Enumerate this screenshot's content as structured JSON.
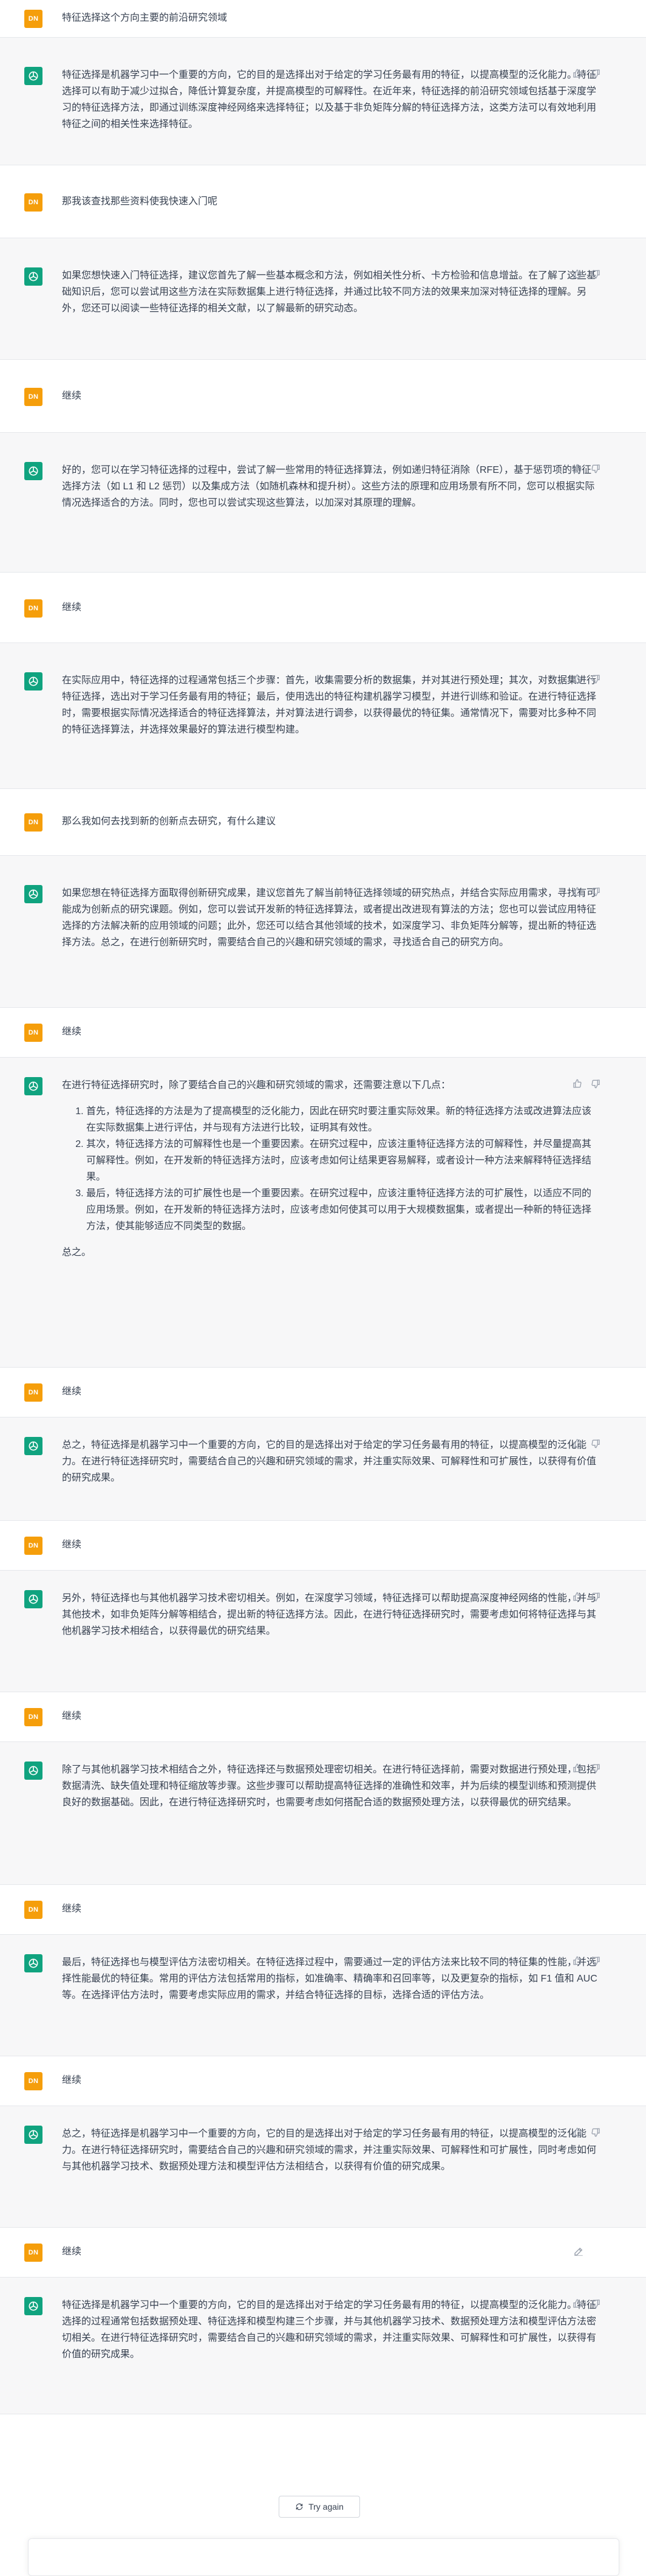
{
  "conversation": {
    "m0": {
      "avatar": "DN",
      "text": "特征选择这个方向主要的前沿研究领域"
    },
    "m1": {
      "text": "特征选择是机器学习中一个重要的方向，它的目的是选择出对于给定的学习任务最有用的特征，以提高模型的泛化能力。特征选择可以有助于减少过拟合，降低计算复杂度，并提高模型的可解释性。在近年来，特征选择的前沿研究领域包括基于深度学习的特征选择方法，即通过训练深度神经网络来选择特征；以及基于非负矩阵分解的特征选择方法，这类方法可以有效地利用特征之间的相关性来选择特征。"
    },
    "m2": {
      "avatar": "DN",
      "text": "那我该查找那些资料使我快速入门呢"
    },
    "m3": {
      "text": "如果您想快速入门特征选择，建议您首先了解一些基本概念和方法，例如相关性分析、卡方检验和信息增益。在了解了这些基础知识后，您可以尝试用这些方法在实际数据集上进行特征选择，并通过比较不同方法的效果来加深对特征选择的理解。另外，您还可以阅读一些特征选择的相关文献，以了解最新的研究动态。"
    },
    "m4": {
      "avatar": "DN",
      "text": "继续"
    },
    "m5": {
      "text": "好的，您可以在学习特征选择的过程中，尝试了解一些常用的特征选择算法，例如递归特征消除（RFE），基于惩罚项的特征选择方法（如 L1 和 L2 惩罚）以及集成方法（如随机森林和提升树）。这些方法的原理和应用场景有所不同，您可以根据实际情况选择适合的方法。同时，您也可以尝试实现这些算法，以加深对其原理的理解。"
    },
    "m6": {
      "avatar": "DN",
      "text": "继续"
    },
    "m7": {
      "text": "在实际应用中，特征选择的过程通常包括三个步骤：首先，收集需要分析的数据集，并对其进行预处理；其次，对数据集进行特征选择，选出对于学习任务最有用的特征；最后，使用选出的特征构建机器学习模型，并进行训练和验证。在进行特征选择时，需要根据实际情况选择适合的特征选择算法，并对算法进行调参，以获得最优的特征集。通常情况下，需要对比多种不同的特征选择算法，并选择效果最好的算法进行模型构建。"
    },
    "m8": {
      "avatar": "DN",
      "text": "那么我如何去找到新的创新点去研究，有什么建议"
    },
    "m9": {
      "text": "如果您想在特征选择方面取得创新研究成果，建议您首先了解当前特征选择领域的研究热点，并结合实际应用需求，寻找有可能成为创新点的研究课题。例如，您可以尝试开发新的特征选择算法，或者提出改进现有算法的方法；您也可以尝试应用特征选择的方法解决新的应用领域的问题；此外，您还可以结合其他领域的技术，如深度学习、非负矩阵分解等，提出新的特征选择方法。总之，在进行创新研究时，需要结合自己的兴趣和研究领域的需求，寻找适合自己的研究方向。"
    },
    "m10": {
      "avatar": "DN",
      "text": "继续"
    },
    "m11": {
      "intro": "在进行特征选择研究时，除了要结合自己的兴趣和研究领域的需求，还需要注意以下几点：",
      "items": [
        "首先，特征选择的方法是为了提高模型的泛化能力，因此在研究时要注重实际效果。新的特征选择方法或改进算法应该在实际数据集上进行评估，并与现有方法进行比较，证明其有效性。",
        "其次，特征选择方法的可解释性也是一个重要因素。在研究过程中，应该注重特征选择方法的可解释性，并尽量提高其可解释性。例如，在开发新的特征选择方法时，应该考虑如何让结果更容易解释，或者设计一种方法来解释特征选择结果。",
        "最后，特征选择方法的可扩展性也是一个重要因素。在研究过程中，应该注重特征选择方法的可扩展性，以适应不同的应用场景。例如，在开发新的特征选择方法时，应该考虑如何使其可以用于大规模数据集，或者提出一种新的特征选择方法，使其能够适应不同类型的数据。"
      ],
      "outro": "总之。"
    },
    "m12": {
      "avatar": "DN",
      "text": "继续"
    },
    "m13": {
      "text": "总之，特征选择是机器学习中一个重要的方向，它的目的是选择出对于给定的学习任务最有用的特征，以提高模型的泛化能力。在进行特征选择研究时，需要结合自己的兴趣和研究领域的需求，并注重实际效果、可解释性和可扩展性，以获得有价值的研究成果。"
    },
    "m14": {
      "avatar": "DN",
      "text": "继续"
    },
    "m15": {
      "text": "另外，特征选择也与其他机器学习技术密切相关。例如，在深度学习领域，特征选择可以帮助提高深度神经网络的性能，并与其他技术，如非负矩阵分解等相结合，提出新的特征选择方法。因此，在进行特征选择研究时，需要考虑如何将特征选择与其他机器学习技术相结合，以获得最优的研究结果。"
    },
    "m16": {
      "avatar": "DN",
      "text": "继续"
    },
    "m17": {
      "text": "除了与其他机器学习技术相结合之外，特征选择还与数据预处理密切相关。在进行特征选择前，需要对数据进行预处理，包括数据清洗、缺失值处理和特征缩放等步骤。这些步骤可以帮助提高特征选择的准确性和效率，并为后续的模型训练和预测提供良好的数据基础。因此，在进行特征选择研究时，也需要考虑如何搭配合适的数据预处理方法，以获得最优的研究结果。"
    },
    "m18": {
      "avatar": "DN",
      "text": "继续"
    },
    "m19": {
      "text": "最后，特征选择也与模型评估方法密切相关。在特征选择过程中，需要通过一定的评估方法来比较不同的特征集的性能，并选择性能最优的特征集。常用的评估方法包括常用的指标，如准确率、精确率和召回率等，以及更复杂的指标，如 F1 值和 AUC 等。在选择评估方法时，需要考虑实际应用的需求，并结合特征选择的目标，选择合适的评估方法。"
    },
    "m20": {
      "avatar": "DN",
      "text": "继续"
    },
    "m21": {
      "text": "总之，特征选择是机器学习中一个重要的方向，它的目的是选择出对于给定的学习任务最有用的特征，以提高模型的泛化能力。在进行特征选择研究时，需要结合自己的兴趣和研究领域的需求，并注重实际效果、可解释性和可扩展性，同时考虑如何与其他机器学习技术、数据预处理方法和模型评估方法相结合，以获得有价值的研究成果。"
    },
    "m22": {
      "avatar": "DN",
      "text": "继续"
    },
    "m23": {
      "text": "特征选择是机器学习中一个重要的方向，它的目的是选择出对于给定的学习任务最有用的特征，以提高模型的泛化能力。特征选择的过程通常包括数据预处理、特征选择和模型构建三个步骤，并与其他机器学习技术、数据预处理方法和模型评估方法密切相关。在进行特征选择研究时，需要结合自己的兴趣和研究领域的需求，并注重实际效果、可解释性和可扩展性，以获得有价值的研究成果。"
    }
  },
  "footer": {
    "try_again_label": "Try again"
  },
  "colors": {
    "user_avatar": "#f59e0b",
    "assistant_avatar": "#10a37f",
    "assistant_bg": "#f7f7f8",
    "text": "#374151",
    "icon_gray": "#9ca3af"
  },
  "icons": {
    "assistant_avatar": "openai-logo-icon",
    "thumbs_up": "thumbs-up-icon",
    "thumbs_down": "thumbs-down-icon",
    "edit": "edit-icon",
    "refresh": "refresh-icon"
  }
}
